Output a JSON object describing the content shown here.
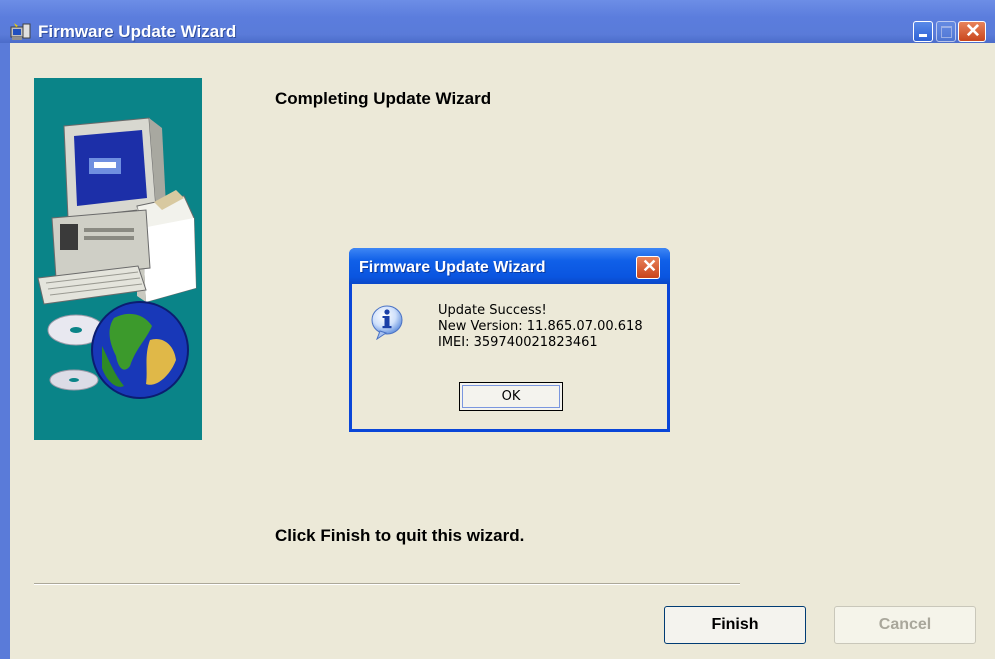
{
  "window": {
    "title": "Firmware Update Wizard",
    "heading": "Completing Update Wizard",
    "instruction": "Click Finish to quit this wizard.",
    "finish_label": "Finish",
    "cancel_label": "Cancel",
    "title_icon": "wizard-app-icon"
  },
  "dialog": {
    "title": "Firmware Update Wizard",
    "icon": "info-icon",
    "line1": "Update Success!",
    "line2": "New Version: 11.865.07.00.618",
    "line3": "IMEI: 359740021823461",
    "ok_label": "OK"
  },
  "colors": {
    "titlebar": "#5a7bd9",
    "panel": "#0a8488",
    "window_bg": "#ece9d8",
    "dialog_frame": "#0a46d8"
  }
}
